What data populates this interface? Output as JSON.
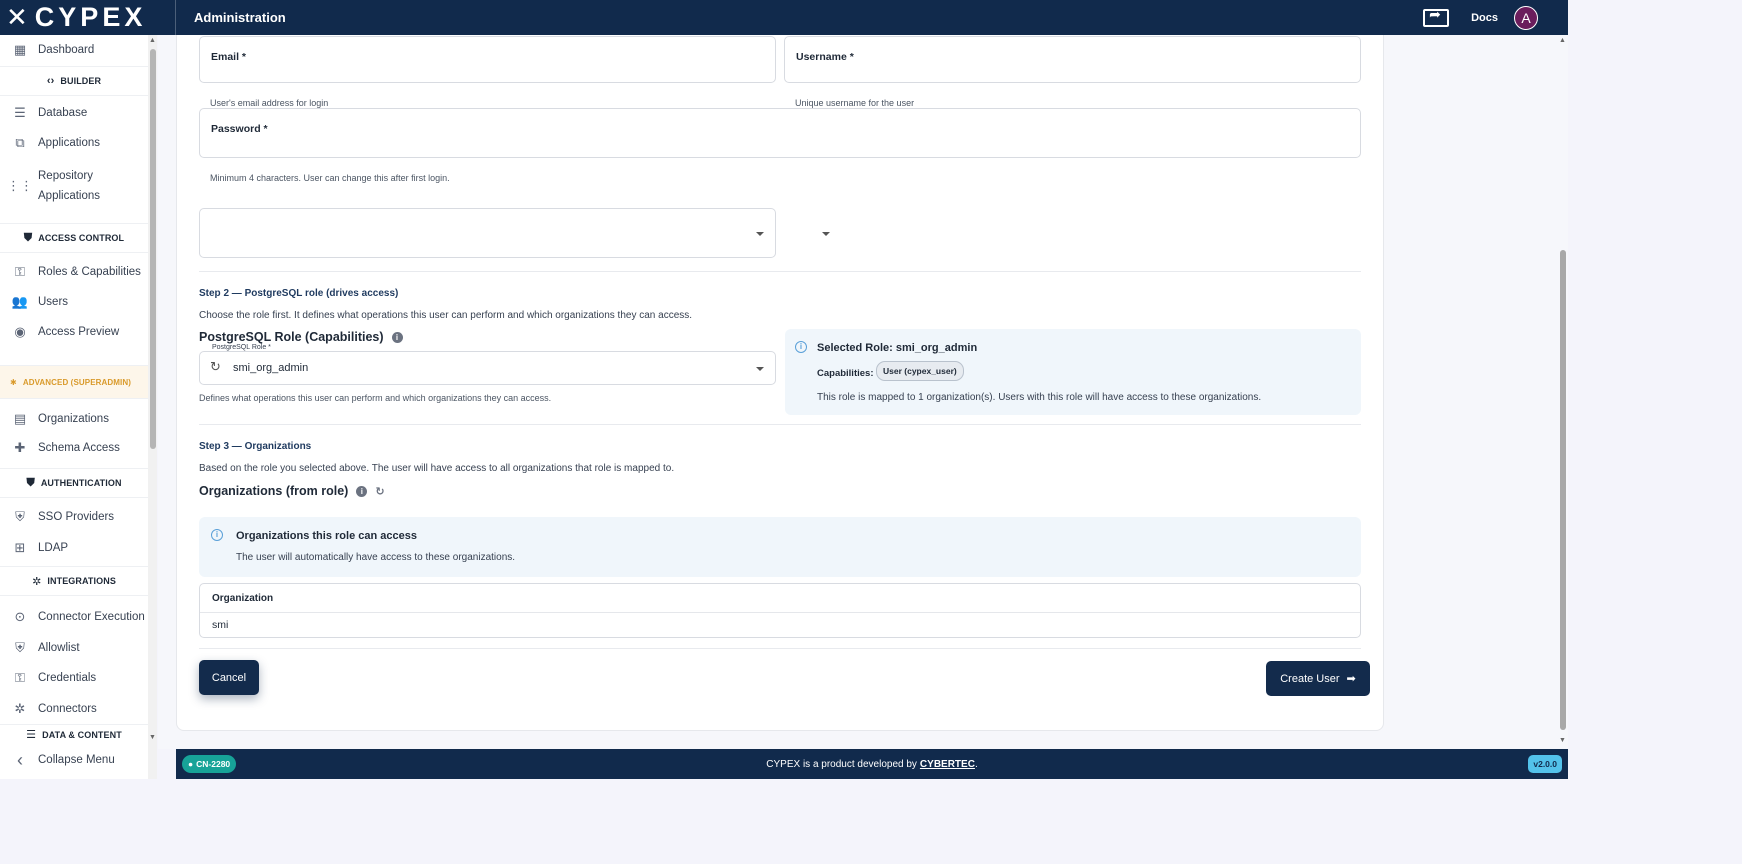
{
  "app": {
    "logo": "CYPEX",
    "title": "Administration",
    "docs": "Docs",
    "avatar": "A"
  },
  "sidebar": {
    "items": [
      {
        "label": "Dashboard"
      },
      {
        "label": "Database"
      },
      {
        "label": "Applications"
      },
      {
        "label": "Repository"
      },
      {
        "label": "Applications"
      },
      {
        "label": "Roles & Capabilities"
      },
      {
        "label": "Users"
      },
      {
        "label": "Access Preview"
      },
      {
        "label": "Organizations"
      },
      {
        "label": "Schema Access"
      },
      {
        "label": "SSO Providers"
      },
      {
        "label": "LDAP"
      },
      {
        "label": "Connector Execution"
      },
      {
        "label": "Allowlist"
      },
      {
        "label": "Credentials"
      },
      {
        "label": "Connectors"
      },
      {
        "label": "Collapse Menu"
      }
    ],
    "sections": {
      "builder": "BUILDER",
      "access_control": "ACCESS CONTROL",
      "advanced": "ADVANCED (SUPERADMIN)",
      "authentication": "AUTHENTICATION",
      "integrations": "INTEGRATIONS",
      "data_content": "DATA & CONTENT"
    }
  },
  "form": {
    "email_label": "Email *",
    "email_helper": "User's email address for login",
    "username_label": "Username *",
    "username_helper": "Unique username for the user",
    "password_label": "Password *",
    "password_helper": "Minimum 4 characters. User can change this after first login.",
    "step2_title": "Step 2 — PostgreSQL role (drives access)",
    "step2_desc": "Choose the role first. It defines what operations this user can perform and which organizations they can access.",
    "role_heading": "PostgreSQL Role (Capabilities)",
    "role_field_label": "PostgreSQL Role *",
    "role_value": "smi_org_admin",
    "role_helper": "Defines what operations this user can perform and which organizations they can access.",
    "selected_role_title": "Selected Role: smi_org_admin",
    "capabilities_label": "Capabilities:",
    "capability_chip": "User (cypex_user)",
    "role_mapping_text": "This role is mapped to 1 organization(s). Users with this role will have access to these organizations.",
    "step3_title": "Step 3 — Organizations",
    "step3_desc": "Based on the role you selected above. The user will have access to all organizations that role is mapped to.",
    "orgs_heading": "Organizations (from role)",
    "orgs_info_title": "Organizations this role can access",
    "orgs_info_desc": "The user will automatically have access to these organizations.",
    "org_table_header": "Organization",
    "org_rows": [
      "smi"
    ],
    "cancel_label": "Cancel",
    "create_label": "Create User"
  },
  "footer": {
    "branch": "CN-2280",
    "text": "CYPEX is a product developed by",
    "company": "CYBERTEC",
    "period": ".",
    "version": "v2.0.0"
  }
}
